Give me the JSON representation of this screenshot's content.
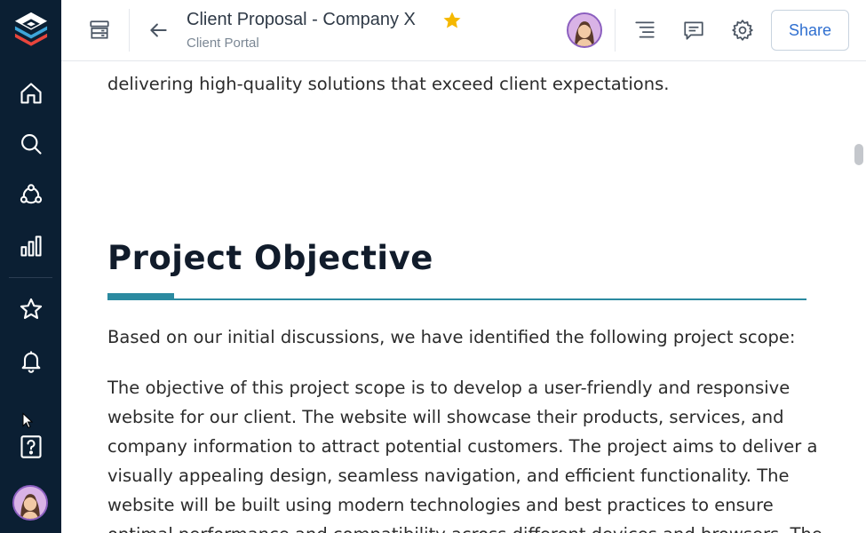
{
  "header": {
    "title": "Client Proposal - Company X",
    "subtitle": "Client Portal",
    "share_label": "Share"
  },
  "sidebar": {
    "items": [
      {
        "icon": "home-icon"
      },
      {
        "icon": "search-icon"
      },
      {
        "icon": "network-icon"
      },
      {
        "icon": "bar-chart-icon"
      },
      {
        "icon": "star-icon"
      },
      {
        "icon": "bell-icon"
      },
      {
        "icon": "help-icon"
      }
    ]
  },
  "document": {
    "intro_tail": "delivering high-quality solutions that exceed client expectations.",
    "section_heading": "Project Objective",
    "scope_intro": "Based on our initial discussions, we have identified the following project scope:",
    "objective_lines": [
      "The objective of this project scope is to develop a user-friendly and responsive",
      "website for our client. The website will showcase their products, services, and",
      "company information to attract potential customers. The project aims to deliver a",
      "visually appealing design, seamless navigation, and efficient functionality. The",
      "website will be built using modern technologies and best practices to ensure",
      "optimal performance and compatibility across different devices and browsers. The"
    ]
  },
  "colors": {
    "sidebar_bg": "#0b1f33",
    "accent": "#2b8aa0",
    "star": "#f5b800",
    "share_text": "#2f6fd0"
  }
}
